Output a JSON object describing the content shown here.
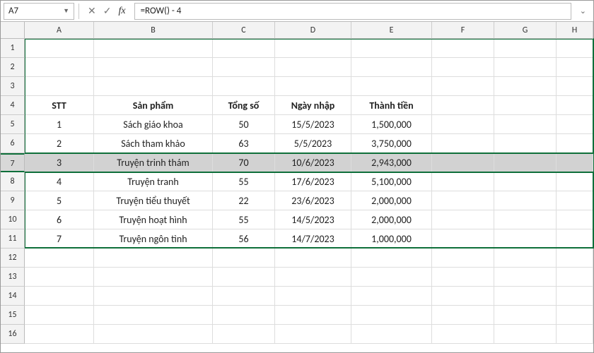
{
  "formula_bar": {
    "name_box": "A7",
    "cancel_icon": "✕",
    "confirm_icon": "✓",
    "fx_label": "fx",
    "formula": "=ROW() - 4",
    "expand_icon": "⌄"
  },
  "columns": [
    "A",
    "B",
    "C",
    "D",
    "E",
    "F",
    "G",
    "H"
  ],
  "rows": [
    "1",
    "2",
    "3",
    "4",
    "5",
    "6",
    "7",
    "8",
    "9",
    "10",
    "11",
    "12",
    "13",
    "14",
    "15",
    "16"
  ],
  "selected_row": "7",
  "headers": {
    "stt": "STT",
    "san_pham": "Sản phẩm",
    "tong_so": "Tổng số",
    "ngay_nhap": "Ngày nhập",
    "thanh_tien": "Thành tiền"
  },
  "data": [
    {
      "stt": "1",
      "sp": "Sách giáo khoa",
      "ts": "50",
      "nn": "15/5/2023",
      "tt": "1,500,000"
    },
    {
      "stt": "2",
      "sp": "Sách tham khảo",
      "ts": "63",
      "nn": "5/5/2023",
      "tt": "3,750,000"
    },
    {
      "stt": "3",
      "sp": "Truyện trinh thám",
      "ts": "70",
      "nn": "10/6/2023",
      "tt": "2,943,000"
    },
    {
      "stt": "4",
      "sp": "Truyện tranh",
      "ts": "55",
      "nn": "17/6/2023",
      "tt": "5,100,000"
    },
    {
      "stt": "5",
      "sp": "Truyện tiểu thuyết",
      "ts": "22",
      "nn": "23/6/2023",
      "tt": "2,000,000"
    },
    {
      "stt": "6",
      "sp": "Truyện hoạt hình",
      "ts": "55",
      "nn": "14/5/2023",
      "tt": "2,000,000"
    },
    {
      "stt": "7",
      "sp": "Truyện ngôn tình",
      "ts": "56",
      "nn": "14/7/2023",
      "tt": "1,000,000"
    }
  ],
  "colors": {
    "selection_border": "#0e6f3a"
  }
}
